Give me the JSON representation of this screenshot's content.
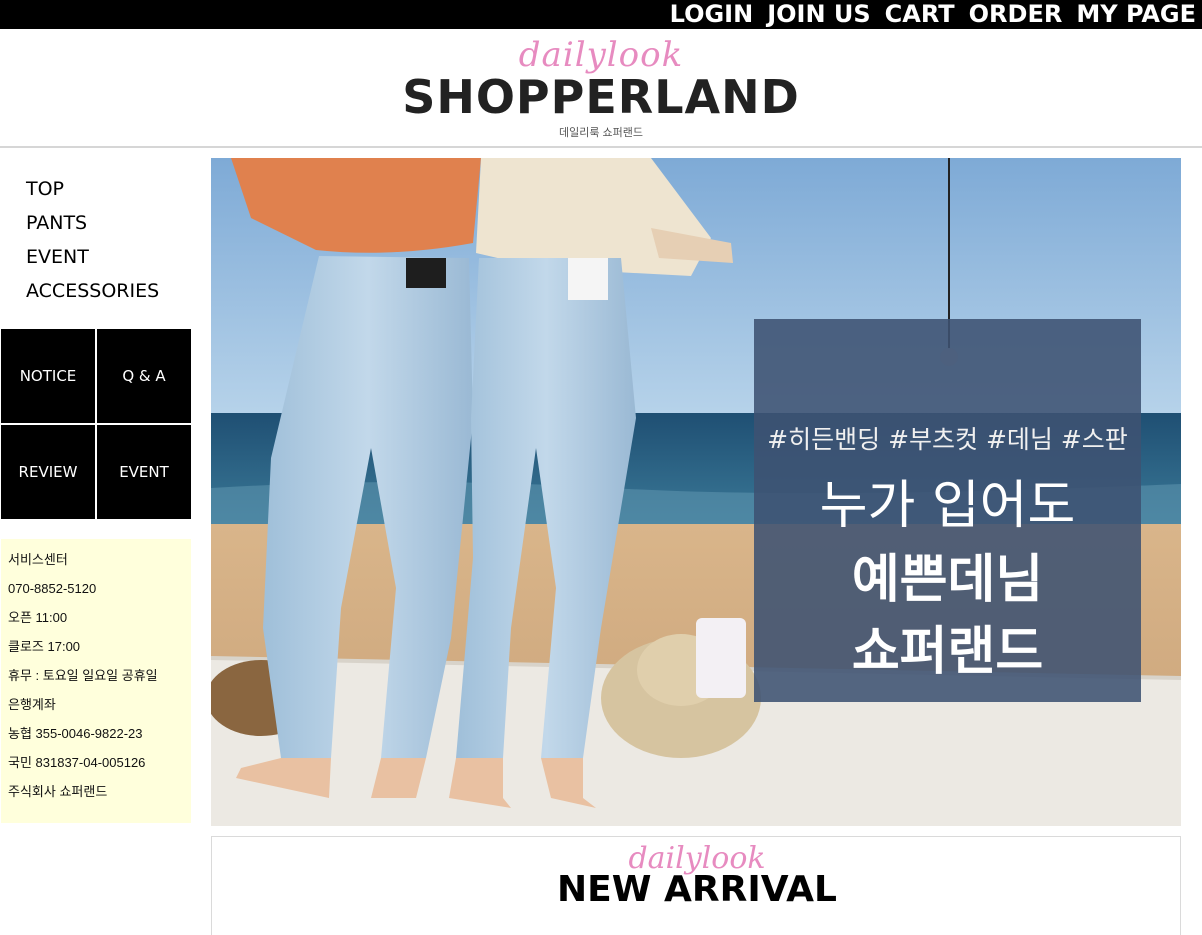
{
  "topnav": {
    "login": "LOGIN",
    "join": "JOIN US",
    "cart": "CART",
    "order": "ORDER",
    "mypage": "MY PAGE"
  },
  "logo": {
    "script": "dailylook",
    "main": "SHOPPERLAND",
    "sub": "데일리룩 쇼퍼랜드"
  },
  "categories": [
    "TOP",
    "PANTS",
    "EVENT",
    "ACCESSORIES"
  ],
  "boxes": [
    "NOTICE",
    "Q & A",
    "REVIEW",
    "EVENT"
  ],
  "service": {
    "title": "서비스센터",
    "phone": "070-8852-5120",
    "open": "오픈 11:00",
    "close": "클로즈 17:00",
    "holiday": "휴무 : 토요일 일요일 공휴일",
    "bank_title": "은행계좌",
    "bank1": "농협 355-0046-9822-23",
    "bank2": "국민 831837-04-005126",
    "company": "주식회사 쇼퍼랜드"
  },
  "banner": {
    "tags": "#히든밴딩 #부츠컷 #데님 #스판",
    "line1": "누가 입어도",
    "line2": "예쁜데님",
    "line3": "쇼퍼랜드"
  },
  "arrival": {
    "script": "dailylook",
    "title": "NEW ARRIVAL"
  },
  "colors": {
    "topbar": "#000000",
    "accent_pink": "#e78bc0",
    "service_bg": "#ffffdc",
    "panel": "#3e5272"
  }
}
